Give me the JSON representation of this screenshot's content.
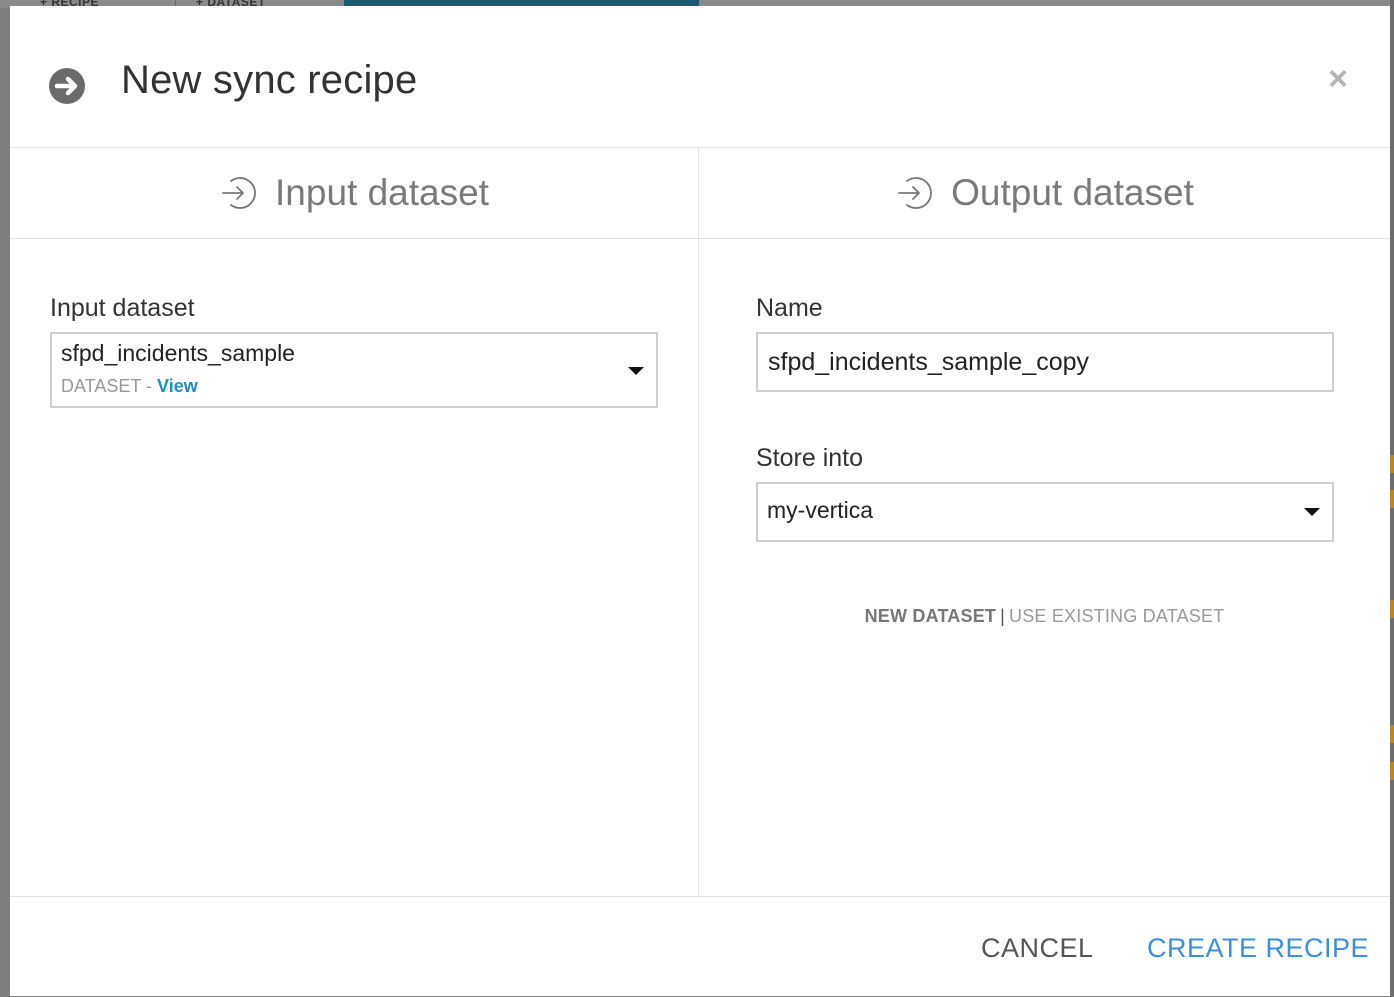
{
  "background": {
    "tab_recipe": "+ RECIPE",
    "tab_dataset": "+ DATASET"
  },
  "modal": {
    "title": "New sync recipe",
    "close_symbol": "×",
    "icon": "arrow-circle-right-icon"
  },
  "input_column": {
    "heading": "Input dataset",
    "field_label": "Input dataset",
    "selected_dataset": "sfpd_incidents_sample",
    "dataset_type": "DATASET",
    "separator": " - ",
    "view_link": "View"
  },
  "output_column": {
    "heading": "Output dataset",
    "name_label": "Name",
    "name_value": "sfpd_incidents_sample_copy",
    "store_label": "Store into",
    "store_value": "my-vertica",
    "mode_new": "NEW DATASET",
    "mode_separator": "|",
    "mode_existing": "USE EXISTING DATASET"
  },
  "footer": {
    "cancel_label": "CANCEL",
    "create_label": "CREATE RECIPE"
  },
  "colors": {
    "accent_link": "#1f8dc1",
    "primary_button": "#3d8fdc",
    "muted_text": "#999999"
  }
}
